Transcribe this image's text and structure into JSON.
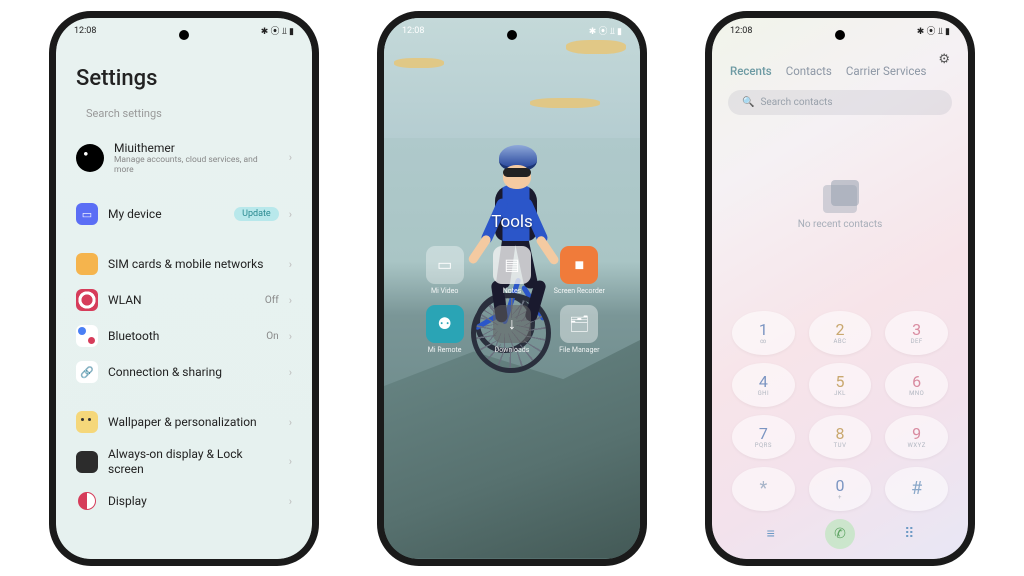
{
  "status": {
    "time": "12:08",
    "icons": "✱ ⦿ ⫫ ▮"
  },
  "settings": {
    "title": "Settings",
    "search_placeholder": "Search settings",
    "account": {
      "name": "Miuithemer",
      "sub": "Manage accounts, cloud services, and more"
    },
    "mydevice": {
      "label": "My device",
      "badge": "Update"
    },
    "items": [
      {
        "label": "SIM cards & mobile networks",
        "trail": ""
      },
      {
        "label": "WLAN",
        "trail": "Off"
      },
      {
        "label": "Bluetooth",
        "trail": "On"
      },
      {
        "label": "Connection & sharing",
        "trail": ""
      }
    ],
    "items2": [
      {
        "label": "Wallpaper & personalization"
      },
      {
        "label": "Always-on display & Lock screen"
      },
      {
        "label": "Display"
      }
    ]
  },
  "home": {
    "folder_label": "Tools",
    "apps": [
      {
        "label": "Mi Video"
      },
      {
        "label": "Notes"
      },
      {
        "label": "Screen Recorder"
      },
      {
        "label": "Mi Remote"
      },
      {
        "label": "Downloads"
      },
      {
        "label": "File Manager"
      }
    ]
  },
  "dialer": {
    "tabs": [
      "Recents",
      "Contacts",
      "Carrier Services"
    ],
    "search_placeholder": "Search contacts",
    "empty": "No recent contacts",
    "keys": [
      {
        "n": "1",
        "l": "∞"
      },
      {
        "n": "2",
        "l": "ABC"
      },
      {
        "n": "3",
        "l": "DEF"
      },
      {
        "n": "4",
        "l": "GHI"
      },
      {
        "n": "5",
        "l": "JKL"
      },
      {
        "n": "6",
        "l": "MNO"
      },
      {
        "n": "7",
        "l": "PQRS"
      },
      {
        "n": "8",
        "l": "TUV"
      },
      {
        "n": "9",
        "l": "WXYZ"
      },
      {
        "n": "*",
        "l": ""
      },
      {
        "n": "0",
        "l": "+"
      },
      {
        "n": "#",
        "l": ""
      }
    ]
  }
}
